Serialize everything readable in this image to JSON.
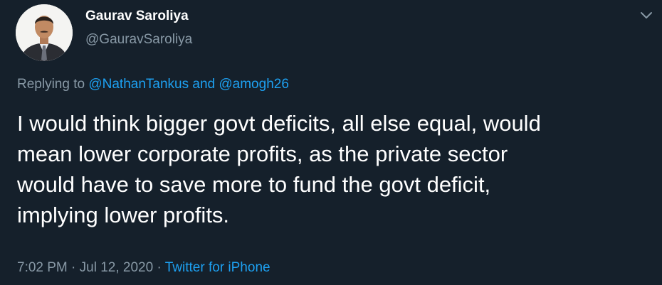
{
  "author": {
    "display_name": "Gaurav Saroliya",
    "handle": "@GauravSaroliya",
    "avatar_icon": "profile-photo"
  },
  "menu": {
    "icon": "chevron-down-icon"
  },
  "reply_context": {
    "prefix": "Replying to ",
    "user_1": "@NathanTankus",
    "joiner": " and ",
    "user_2": "@amogh26"
  },
  "tweet": {
    "text": "I would think bigger govt deficits, all else equal, would\nmean lower corporate profits, as the private sector\nwould have to save more to fund the govt deficit,\nimplying lower profits."
  },
  "meta": {
    "time": "7:02 PM",
    "separator_1": " · ",
    "date": "Jul 12, 2020",
    "separator_2": " · ",
    "source": "Twitter for iPhone"
  },
  "colors": {
    "background": "#15202b",
    "primary_text": "#ffffff",
    "secondary_text": "#8899a6",
    "link": "#1da1f2"
  }
}
